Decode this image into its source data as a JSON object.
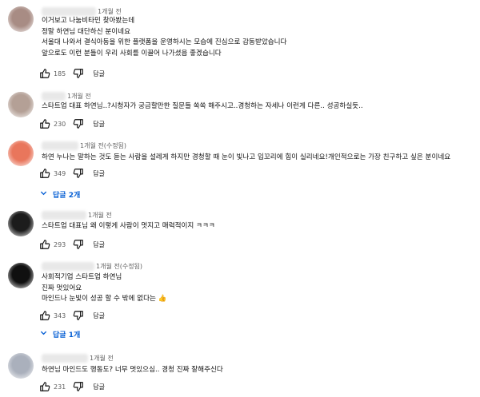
{
  "comments": [
    {
      "avatar_color": "#a88c84",
      "time": "1개월 전",
      "lines": [
        "이거보고 나눔비타민 찾아봤는데",
        "정말 하연님 대단하신 분이네요",
        "서울대 나와서 결식아동을 위한 플랫폼을 운영하시는 모습에 진심으로 감동받았습니다",
        "앞으로도 이런 분들이 우리 사회를 이끌어 나가셨음 좋겠습니다"
      ],
      "likes": "185",
      "reply_label": "답글"
    },
    {
      "avatar_color": "#b4a096",
      "time": "1개월 전",
      "lines": [
        "스타트업 대표 하연님..?시청자가 궁금할만한 질문들 쏙쏙 해주시고..경청하는 자세나 이런게 다른.. 성공하실듯.."
      ],
      "likes": "230",
      "reply_label": "답글"
    },
    {
      "avatar_color": "#e9765c",
      "time": "1개월 전(수정됨)",
      "lines": [
        "하연 누나는 말하는 것도 듣는 사람을 설레게 하지만  경청할 때 눈이 빛나고 입꼬리에 힘이 실리네요!개인적으로는 가장 친구하고 싶은 분이네요"
      ],
      "likes": "349",
      "reply_label": "답글",
      "replies_label": "답글 2개"
    },
    {
      "avatar_color": "#1c1c1c",
      "time": "1개월 전",
      "lines": [
        "스타트업 대표님 왜 이렇게 사람이 멋지고 매력적이지 ㅋㅋㅋ"
      ],
      "likes": "293",
      "reply_label": "답글"
    },
    {
      "avatar_color": "#101010",
      "time": "1개월 전(수정됨)",
      "lines": [
        "사회적기업 스타트업 하연님",
        "진짜 멋있어요",
        "마인드나 눈빛이 성공 할 수 밖에 없다는 👍"
      ],
      "likes": "343",
      "reply_label": "답글",
      "replies_label": "답글 1개"
    },
    {
      "avatar_color": "#aab0bc",
      "time": "1개월 전",
      "lines": [
        "하연님 마인드도 행동도? 너무 멋있으심.. 경청 진짜 잘해주신다"
      ],
      "likes": "231",
      "reply_label": "답글"
    }
  ]
}
